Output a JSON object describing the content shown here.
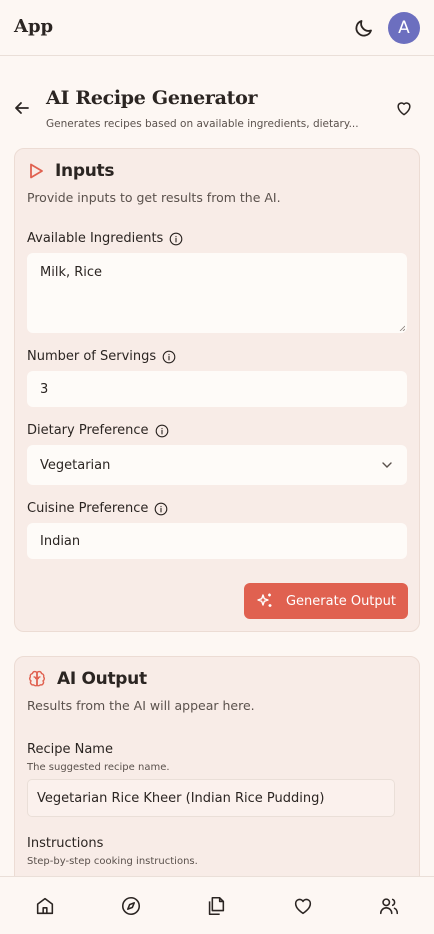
{
  "app": {
    "title": "App",
    "avatar_letter": "A"
  },
  "page": {
    "title": "AI Recipe Generator",
    "subtitle": "Generates recipes based on available ingredients, dietary..."
  },
  "inputs_card": {
    "title": "Inputs",
    "description": "Provide inputs to get results from the AI.",
    "fields": {
      "ingredients": {
        "label": "Available Ingredients",
        "value": "Milk, Rice"
      },
      "servings": {
        "label": "Number of Servings",
        "value": "3"
      },
      "diet": {
        "label": "Dietary Preference",
        "value": "Vegetarian"
      },
      "cuisine": {
        "label": "Cuisine Preference",
        "value": "Indian"
      }
    },
    "generate_label": "Generate Output"
  },
  "output_card": {
    "title": "AI Output",
    "description": "Results from the AI will appear here.",
    "recipe_name": {
      "label": "Recipe Name",
      "hint": "The suggested recipe name.",
      "value": "Vegetarian Rice Kheer (Indian Rice Pudding)"
    },
    "instructions": {
      "label": "Instructions",
      "hint": "Step-by-step cooking instructions."
    }
  },
  "bottom_nav": {
    "items": [
      "home-icon",
      "compass-icon",
      "documents-icon",
      "heart-icon",
      "users-icon"
    ]
  },
  "colors": {
    "accent": "#e06150",
    "avatar": "#6c6fbf",
    "background": "#fdf7f3",
    "card": "#f8ece7"
  }
}
